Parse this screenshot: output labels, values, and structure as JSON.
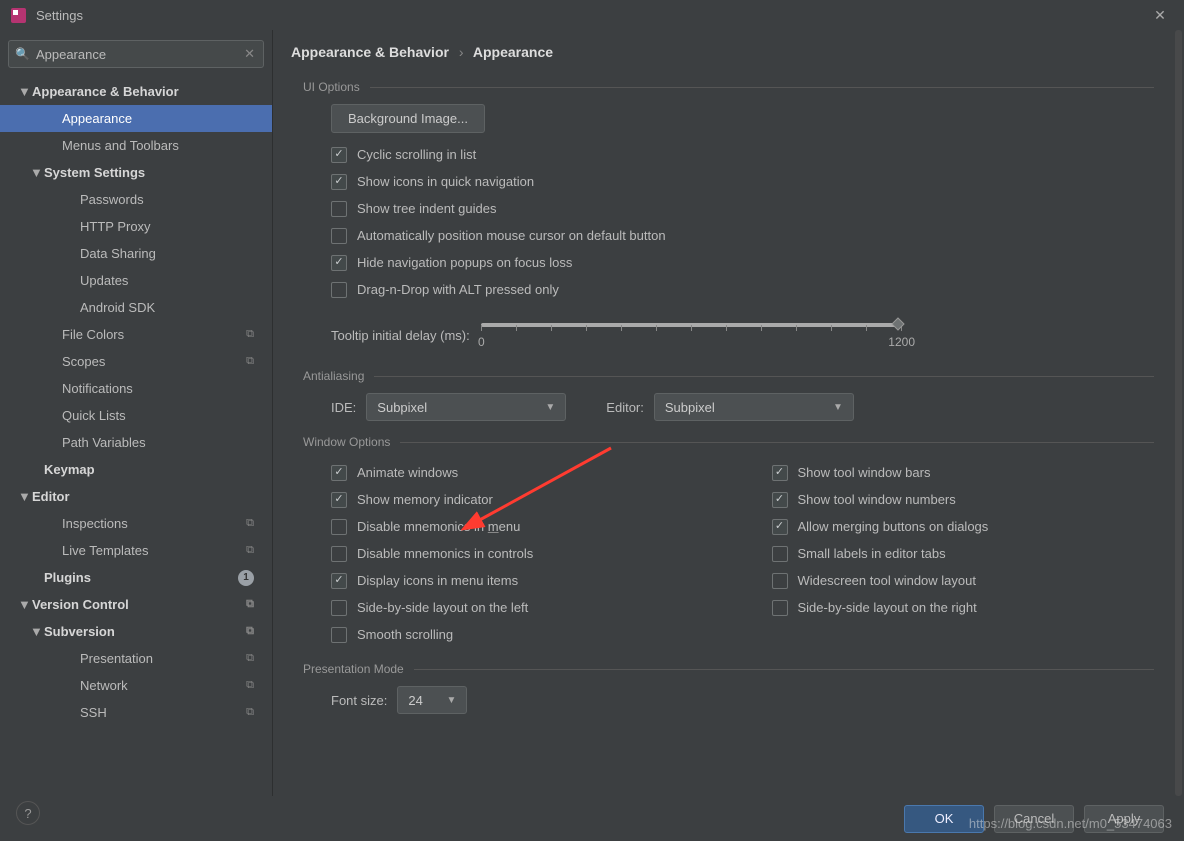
{
  "window": {
    "title": "Settings"
  },
  "search": {
    "value": "Appearance"
  },
  "sidebar": {
    "items": [
      {
        "label": "Appearance & Behavior",
        "bold": true,
        "arrow": "▼",
        "lvl": 0
      },
      {
        "label": "Appearance",
        "lvl": 2,
        "selected": true
      },
      {
        "label": "Menus and Toolbars",
        "lvl": 2
      },
      {
        "label": "System Settings",
        "bold": true,
        "arrow": "▼",
        "lvl": 1
      },
      {
        "label": "Passwords",
        "lvl": 3
      },
      {
        "label": "HTTP Proxy",
        "lvl": 3
      },
      {
        "label": "Data Sharing",
        "lvl": 3
      },
      {
        "label": "Updates",
        "lvl": 3
      },
      {
        "label": "Android SDK",
        "lvl": 3
      },
      {
        "label": "File Colors",
        "lvl": 2,
        "copy": true
      },
      {
        "label": "Scopes",
        "lvl": 2,
        "copy": true
      },
      {
        "label": "Notifications",
        "lvl": 2
      },
      {
        "label": "Quick Lists",
        "lvl": 2
      },
      {
        "label": "Path Variables",
        "lvl": 2
      },
      {
        "label": "Keymap",
        "bold": true,
        "lvl": 1
      },
      {
        "label": "Editor",
        "bold": true,
        "arrow": "▼",
        "lvl": 0
      },
      {
        "label": "Inspections",
        "lvl": 2,
        "copy": true
      },
      {
        "label": "Live Templates",
        "lvl": 2,
        "copy": true
      },
      {
        "label": "Plugins",
        "bold": true,
        "lvl": 1,
        "count": "1"
      },
      {
        "label": "Version Control",
        "bold": true,
        "arrow": "▼",
        "lvl": 0,
        "copy": true
      },
      {
        "label": "Subversion",
        "bold": true,
        "arrow": "▼",
        "lvl": 1,
        "copy": true
      },
      {
        "label": "Presentation",
        "lvl": 3,
        "copy": true
      },
      {
        "label": "Network",
        "lvl": 3,
        "copy": true
      },
      {
        "label": "SSH",
        "lvl": 3,
        "copy": true
      }
    ]
  },
  "breadcrumb": {
    "a": "Appearance & Behavior",
    "b": "Appearance"
  },
  "ui_options": {
    "heading": "UI Options",
    "bg_button": "Background Image...",
    "checks": [
      {
        "label": "Cyclic scrolling in list",
        "checked": true
      },
      {
        "label": "Show icons in quick navigation",
        "checked": true
      },
      {
        "label": "Show tree indent guides",
        "checked": false
      },
      {
        "label": "Automatically position mouse cursor on default button",
        "checked": false
      },
      {
        "label": "Hide navigation popups on focus loss",
        "checked": true
      },
      {
        "label": "Drag-n-Drop with ALT pressed only",
        "checked": false
      }
    ],
    "slider": {
      "label": "Tooltip initial delay (ms):",
      "min": "0",
      "max": "1200"
    }
  },
  "antialiasing": {
    "heading": "Antialiasing",
    "ide_label": "IDE:",
    "ide_value": "Subpixel",
    "editor_label": "Editor:",
    "editor_value": "Subpixel"
  },
  "window_options": {
    "heading": "Window Options",
    "left": [
      {
        "label": "Animate windows",
        "checked": true
      },
      {
        "label": "Show memory indicator",
        "checked": true
      },
      {
        "label": "Disable mnemonics in menu",
        "checked": false,
        "underline": "m"
      },
      {
        "label": "Disable mnemonics in controls",
        "checked": false
      },
      {
        "label": "Display icons in menu items",
        "checked": true
      },
      {
        "label": "Side-by-side layout on the left",
        "checked": false
      },
      {
        "label": "Smooth scrolling",
        "checked": false
      }
    ],
    "right": [
      {
        "label": "Show tool window bars",
        "checked": true
      },
      {
        "label": "Show tool window numbers",
        "checked": true
      },
      {
        "label": "Allow merging buttons on dialogs",
        "checked": true
      },
      {
        "label": "Small labels in editor tabs",
        "checked": false
      },
      {
        "label": "Widescreen tool window layout",
        "checked": false
      },
      {
        "label": "Side-by-side layout on the right",
        "checked": false
      }
    ]
  },
  "presentation": {
    "heading": "Presentation Mode",
    "font_label": "Font size:",
    "font_value": "24"
  },
  "footer": {
    "ok": "OK",
    "cancel": "Cancel",
    "apply": "Apply"
  },
  "watermark": "https://blog.csdn.net/m0_53474063"
}
